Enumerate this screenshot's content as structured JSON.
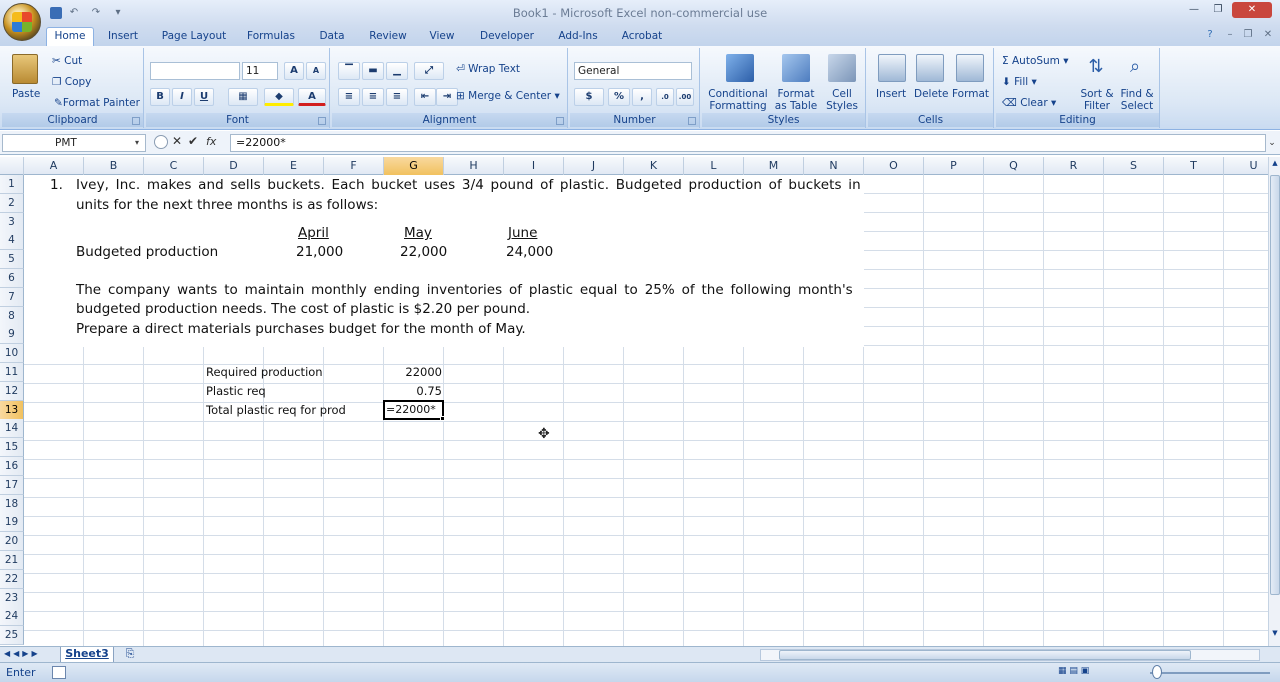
{
  "window": {
    "title": "Book1 - Microsoft Excel non-commercial use"
  },
  "tabs": [
    "Home",
    "Insert",
    "Page Layout",
    "Formulas",
    "Data",
    "Review",
    "View",
    "Developer",
    "Add-Ins",
    "Acrobat"
  ],
  "ribbon": {
    "clipboard": {
      "label": "Clipboard",
      "paste": "Paste",
      "cut": "Cut",
      "copy": "Copy",
      "painter": "Format Painter"
    },
    "font": {
      "label": "Font",
      "size": "11",
      "bold": "B",
      "italic": "I",
      "underline": "U",
      "grow": "A",
      "shrink": "A"
    },
    "alignment": {
      "label": "Alignment",
      "wrap": "Wrap Text",
      "merge": "Merge & Center"
    },
    "number": {
      "label": "Number",
      "format": "General",
      "currency": "$",
      "percent": "%",
      "comma": ","
    },
    "styles": {
      "label": "Styles",
      "conditional1": "Conditional",
      "conditional2": "Formatting",
      "table1": "Format",
      "table2": "as Table",
      "cell1": "Cell",
      "cell2": "Styles"
    },
    "cells": {
      "label": "Cells",
      "insert": "Insert",
      "delete": "Delete",
      "format": "Format"
    },
    "editing": {
      "label": "Editing",
      "autosum": "AutoSum",
      "fill": "Fill",
      "clear": "Clear",
      "sort1": "Sort &",
      "sort2": "Filter",
      "find1": "Find &",
      "find2": "Select"
    }
  },
  "formula_bar": {
    "name_box": "PMT",
    "fx": "fx",
    "content": "=22000*"
  },
  "columns": [
    "A",
    "B",
    "C",
    "D",
    "E",
    "F",
    "G",
    "H",
    "I",
    "J",
    "K",
    "L",
    "M",
    "N",
    "O",
    "P",
    "Q",
    "R",
    "S",
    "T",
    "U"
  ],
  "selected_column": "G",
  "rows": [
    "1",
    "2",
    "3",
    "4",
    "5",
    "6",
    "7",
    "8",
    "9",
    "10",
    "11",
    "12",
    "13",
    "14",
    "15",
    "16",
    "17",
    "18",
    "19",
    "20",
    "21",
    "22",
    "23",
    "24",
    "25"
  ],
  "selected_row": "13",
  "problem": {
    "num": "1.",
    "p1l1": "Ivey, Inc. makes and sells buckets. Each bucket uses 3/4 pound of plastic. Budgeted production of buckets in",
    "p1l2": "units for the next three months is as follows:",
    "months": [
      "April",
      "May",
      "June"
    ],
    "row_label": "Budgeted production",
    "values": [
      "21,000",
      "22,000",
      "24,000"
    ],
    "p2l1": "The company wants to maintain monthly ending inventories of plastic equal to 25% of the following month's",
    "p2l2": "budgeted production needs. The cost of plastic is $2.20 per pound.",
    "p2l3": "Prepare a direct materials purchases budget for the month of May."
  },
  "cells": {
    "d11": "Required production",
    "g11": "22000",
    "d12": "Plastic req",
    "g12": "0.75",
    "d13": "Total plastic req for prod",
    "g13": "=22000*"
  },
  "sheet_tab": "Sheet3",
  "status": "Enter"
}
